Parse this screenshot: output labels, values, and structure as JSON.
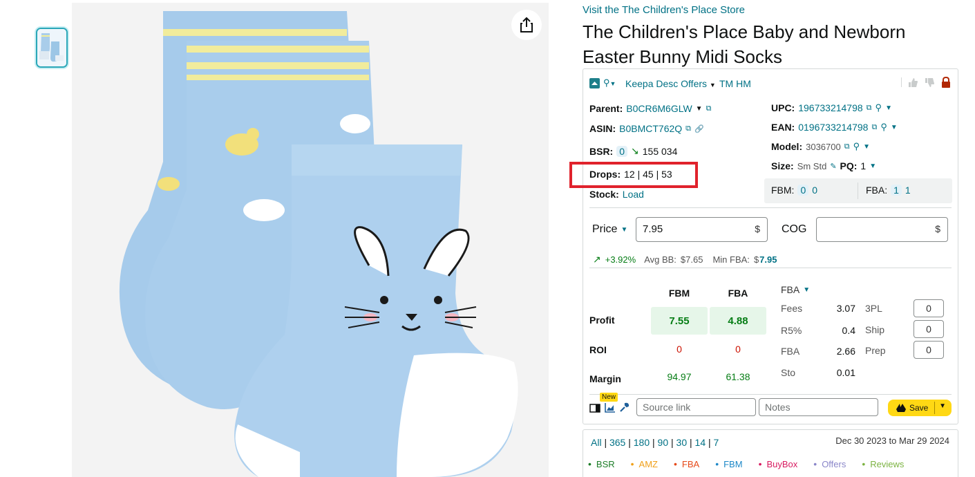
{
  "store_link": "Visit the The Children's Place Store",
  "title": "The Children's Place Baby and Newborn Easter Bunny Midi Socks",
  "panel": {
    "header": {
      "keepa_label": "Keepa Desc Offers",
      "tm_label": "TM HM"
    },
    "parent": {
      "label": "Parent:",
      "value": "B0CR6M6GLW"
    },
    "asin": {
      "label": "ASIN:",
      "value": "B0BMCT762Q"
    },
    "bsr": {
      "label": "BSR:",
      "badge": "0",
      "value": "155 034"
    },
    "drops": {
      "label": "Drops:",
      "value": "12 | 45 | 53"
    },
    "stock": {
      "label": "Stock:",
      "value": "Load"
    },
    "upc": {
      "label": "UPC:",
      "value": "196733214798"
    },
    "ean": {
      "label": "EAN:",
      "value": "0196733214798"
    },
    "model": {
      "label": "Model:",
      "value": "3036700"
    },
    "size": {
      "label": "Size:",
      "value": "Sm Std",
      "pq_label": "PQ:",
      "pq_value": "1"
    },
    "fbm_count": {
      "label": "FBM:",
      "badge": "0",
      "value": "0"
    },
    "fba_count": {
      "label": "FBA:",
      "badge": "1",
      "value": "1"
    },
    "price": {
      "label": "Price",
      "value": "7.95",
      "currency": "$"
    },
    "cog": {
      "label": "COG",
      "value": "",
      "currency": "$"
    },
    "stats": {
      "change": "+3.92%",
      "avg_bb_label": "Avg BB:",
      "avg_bb": "$7.65",
      "min_fba_label": "Min FBA:",
      "min_fba_prefix": "$",
      "min_fba": "7.95"
    },
    "calc": {
      "col_fbm": "FBM",
      "col_fba": "FBA",
      "profit_label": "Profit",
      "profit_fbm": "7.55",
      "profit_fba": "4.88",
      "roi_label": "ROI",
      "roi_fbm": "0",
      "roi_fba": "0",
      "margin_label": "Margin",
      "margin_fbm": "94.97",
      "margin_fba": "61.38"
    },
    "fees": {
      "mode": "FBA",
      "fees_label": "Fees",
      "fees_value": "3.07",
      "r5_label": "R5%",
      "r5_value": "0.4",
      "fba_label": "FBA",
      "fba_value": "2.66",
      "sto_label": "Sto",
      "sto_value": "0.01",
      "tpl_label": "3PL",
      "tpl_value": "0",
      "ship_label": "Ship",
      "ship_value": "0",
      "prep_label": "Prep",
      "prep_value": "0"
    },
    "bottom": {
      "new_badge": "New",
      "source_placeholder": "Source link",
      "notes_placeholder": "Notes",
      "save_label": "Save"
    }
  },
  "chart": {
    "ranges": [
      "All",
      "365",
      "180",
      "90",
      "30",
      "14",
      "7"
    ],
    "date_range": "Dec 30 2023 to Mar 29 2024",
    "legend": [
      {
        "label": "BSR",
        "color": "#1c7d27"
      },
      {
        "label": "AMZ",
        "color": "#f0a01a"
      },
      {
        "label": "FBA",
        "color": "#e64a19"
      },
      {
        "label": "FBM",
        "color": "#1e88c8"
      },
      {
        "label": "BuyBox",
        "color": "#d81b60"
      },
      {
        "label": "Offers",
        "color": "#8a86c9"
      },
      {
        "label": "Reviews",
        "color": "#7cb342"
      }
    ]
  },
  "colors": {
    "link": "#007185",
    "highlight_box": "#e0222c",
    "save_button": "#ffd814"
  }
}
